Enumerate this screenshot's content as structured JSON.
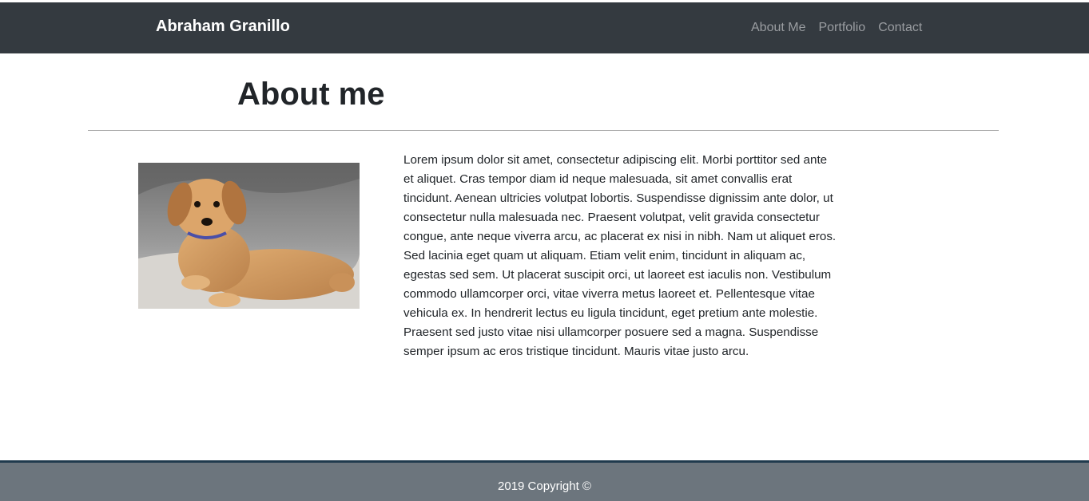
{
  "navbar": {
    "brand": "Abraham Granillo",
    "links": [
      "About Me",
      "Portfolio",
      "Contact"
    ]
  },
  "main": {
    "title": "About me",
    "image_subject": "puppy-photo",
    "bio": "Lorem ipsum dolor sit amet, consectetur adipiscing elit. Morbi porttitor sed ante et aliquet. Cras tempor diam id neque malesuada, sit amet convallis erat tincidunt. Aenean ultricies volutpat lobortis. Suspendisse dignissim ante dolor, ut consectetur nulla malesuada nec. Praesent volutpat, velit gravida consectetur congue, ante neque viverra arcu, ac placerat ex nisi in nibh. Nam ut aliquet eros. Sed lacinia eget quam ut aliquam. Etiam velit enim, tincidunt in aliquam ac, egestas sed sem. Ut placerat suscipit orci, ut laoreet est iaculis non. Vestibulum commodo ullamcorper orci, vitae viverra metus laoreet et. Pellentesque vitae vehicula ex. In hendrerit lectus eu ligula tincidunt, eget pretium ante molestie. Praesent sed justo vitae nisi ullamcorper posuere sed a magna. Suspendisse semper ipsum ac eros tristique tincidunt. Mauris vitae justo arcu."
  },
  "footer": {
    "copyright": "2019 Copyright ©"
  },
  "colors": {
    "navbar_bg": "#343a40",
    "nav_link": "#9a9da1",
    "footer_bg": "#6c757d",
    "footer_border": "#1f3a4d"
  }
}
